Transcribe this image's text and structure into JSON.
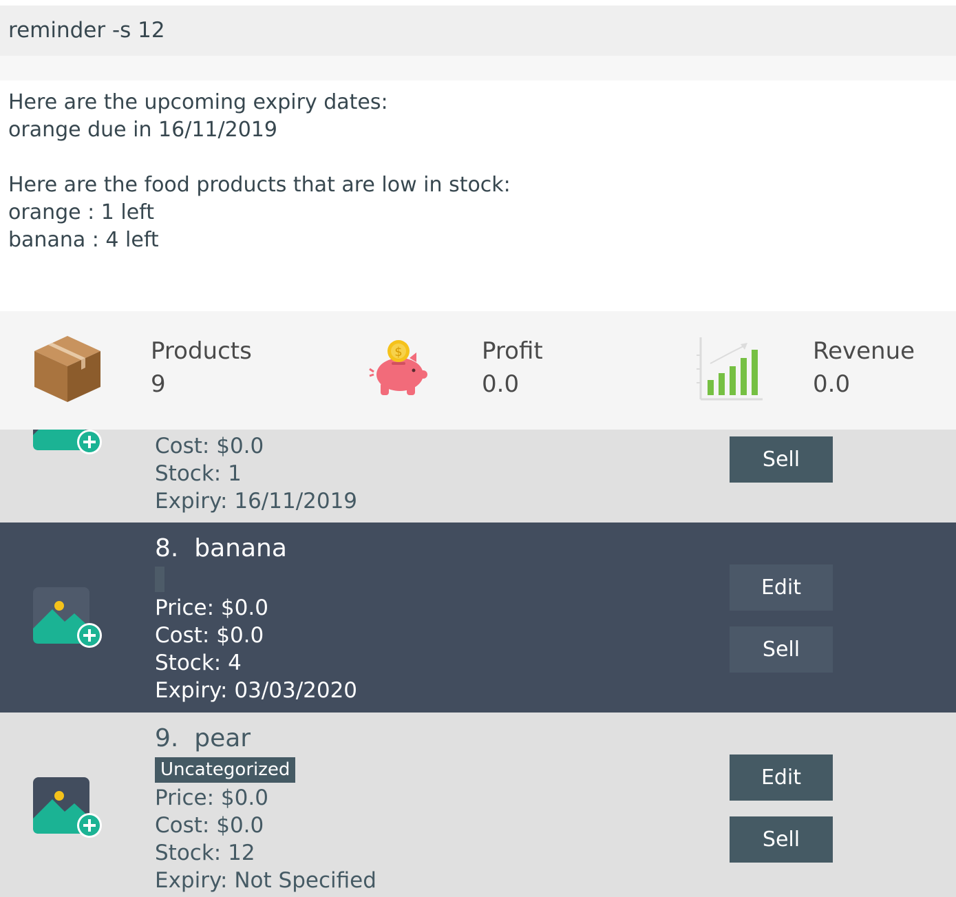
{
  "command": {
    "text": "reminder -s 12"
  },
  "result": {
    "text": "Here are the upcoming expiry dates:\norange due in 16/11/2019\n\nHere are the food products that are low in stock:\norange : 1 left\nbanana : 4 left"
  },
  "stats": {
    "products": {
      "label": "Products",
      "value": "9",
      "icon": "box-icon"
    },
    "profit": {
      "label": "Profit",
      "value": "0.0",
      "icon": "piggy-bank-icon"
    },
    "revenue": {
      "label": "Revenue",
      "value": "0.0",
      "icon": "bar-chart-icon"
    }
  },
  "products": [
    {
      "cost": "Cost: $0.0",
      "stock": "Stock: 1",
      "expiry": "Expiry: 16/11/2019",
      "sell_label": "Sell",
      "icon": "add-image-icon"
    },
    {
      "index": "8.",
      "name": "banana",
      "tag": "",
      "price": "Price: $0.0",
      "cost": "Cost: $0.0",
      "stock": "Stock: 4",
      "expiry": "Expiry: 03/03/2020",
      "edit_label": "Edit",
      "sell_label": "Sell",
      "icon": "add-image-icon"
    },
    {
      "index": "9.",
      "name": "pear",
      "tag": "Uncategorized",
      "price": "Price: $0.0",
      "cost": "Cost: $0.0",
      "stock": "Stock: 12",
      "expiry": "Expiry: Not Specified",
      "edit_label": "Edit",
      "sell_label": "Sell",
      "icon": "add-image-icon"
    }
  ],
  "colors": {
    "light_card": "#e0e0e0",
    "dark_card": "#424d5e",
    "button": "#455a64",
    "accent_green": "#1bb394"
  }
}
